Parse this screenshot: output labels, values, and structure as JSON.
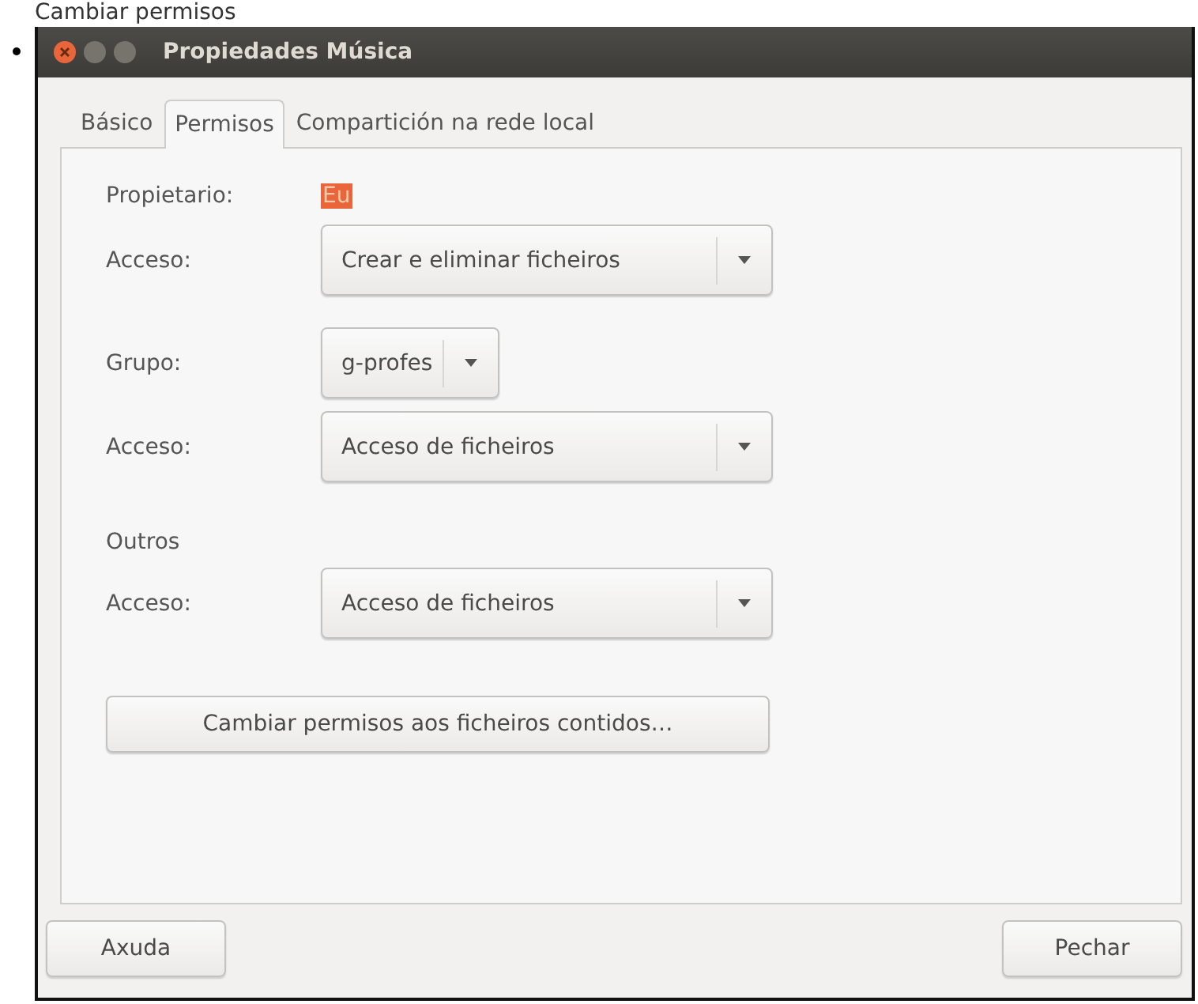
{
  "page_heading": "Cambiar permisos",
  "window": {
    "title": "Propiedades Música"
  },
  "tabs": [
    {
      "label": "Básico",
      "selected": false
    },
    {
      "label": "Permisos",
      "selected": true
    },
    {
      "label": "Compartición na rede local",
      "selected": false
    }
  ],
  "owner": {
    "label": "Propietario:",
    "value": "Eu",
    "highlighted": true
  },
  "owner_access": {
    "label": "Acceso:",
    "value": "Crear e eliminar ficheiros"
  },
  "group": {
    "label": "Grupo:",
    "value": "g-profes"
  },
  "group_access": {
    "label": "Acceso:",
    "value": "Acceso de ficheiros"
  },
  "others": {
    "heading": "Outros",
    "label": "Acceso:",
    "value": "Acceso de ficheiros"
  },
  "apply_button": "Cambiar permisos aos ficheiros contidos…",
  "buttons": {
    "help": "Axuda",
    "close": "Pechar"
  }
}
